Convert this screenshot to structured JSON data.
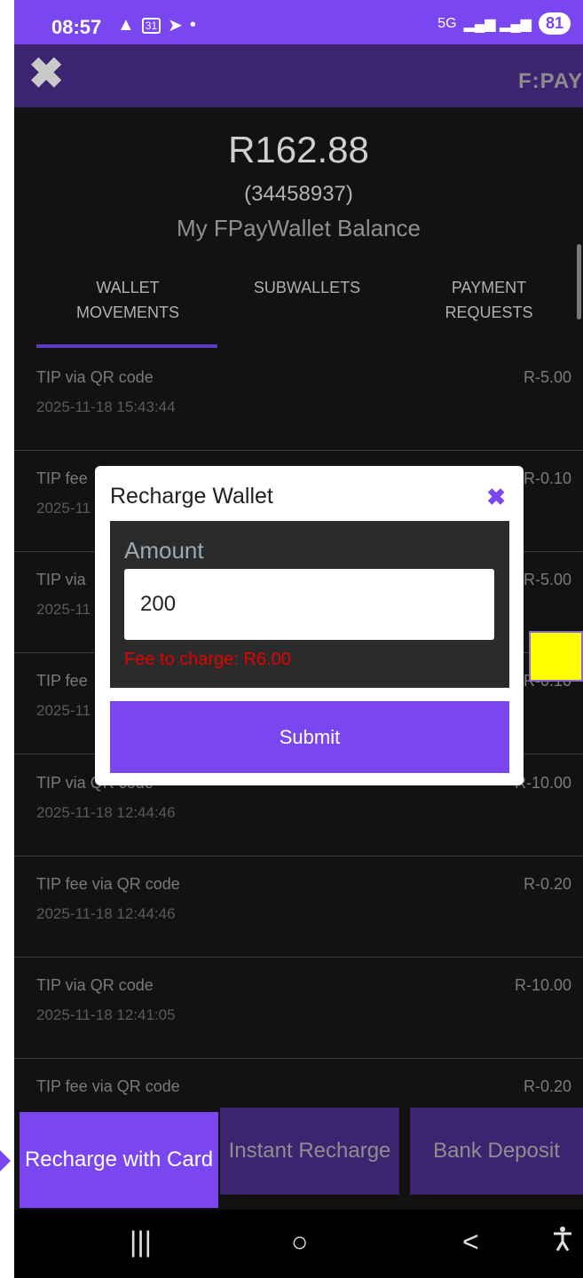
{
  "status_bar": {
    "time": "08:57",
    "icons": [
      "warning-icon",
      "calendar-icon",
      "telegram-icon",
      "dot-icon"
    ],
    "network": "5G",
    "battery": "81"
  },
  "app_bar": {
    "close_icon": "✖",
    "logo_text": "F:PAY"
  },
  "header": {
    "balance": "R162.88",
    "account": "(34458937)",
    "wallet_title": "My FPayWallet Balance"
  },
  "tabs": [
    {
      "label": "WALLET\nMOVEMENTS"
    },
    {
      "label": "SUBWALLETS"
    },
    {
      "label": "PAYMENT\nREQUESTS"
    }
  ],
  "transactions": [
    {
      "title": "TIP via QR code",
      "date": "2025-11-18 15:43:44",
      "amount": "R-5.00"
    },
    {
      "title": "TIP fee",
      "date": "2025-11",
      "amount": "R-0.10"
    },
    {
      "title": "TIP via",
      "date": "2025-11",
      "amount": "R-5.00"
    },
    {
      "title": "TIP fee",
      "date": "2025-11",
      "amount": "R-0.10"
    },
    {
      "title": "TIP via QR code",
      "date": "2025-11-18 12:44:46",
      "amount": "R-10.00"
    },
    {
      "title": "TIP fee via QR code",
      "date": "2025-11-18 12:44:46",
      "amount": "R-0.20"
    },
    {
      "title": "TIP via QR code",
      "date": "2025-11-18 12:41:05",
      "amount": "R-10.00"
    },
    {
      "title": "TIP fee via QR code",
      "date": "",
      "amount": "R-0.20"
    }
  ],
  "modal": {
    "title": "Recharge Wallet",
    "close": "✖",
    "amount_label": "Amount",
    "amount_value": "200",
    "fee_text": "Fee to charge: R6.00",
    "submit_label": "Submit"
  },
  "bottom_buttons": [
    {
      "label": "Recharge with Card"
    },
    {
      "label": "Instant Recharge"
    },
    {
      "label": "Bank Deposit"
    }
  ],
  "nav": {
    "recents": "|||",
    "home": "○",
    "back": "<",
    "accessibility": "accessibility-icon"
  },
  "colors": {
    "accent": "#7a46f0",
    "app_bar": "#3d2470",
    "background": "#121212",
    "fee_red": "#e60000"
  }
}
